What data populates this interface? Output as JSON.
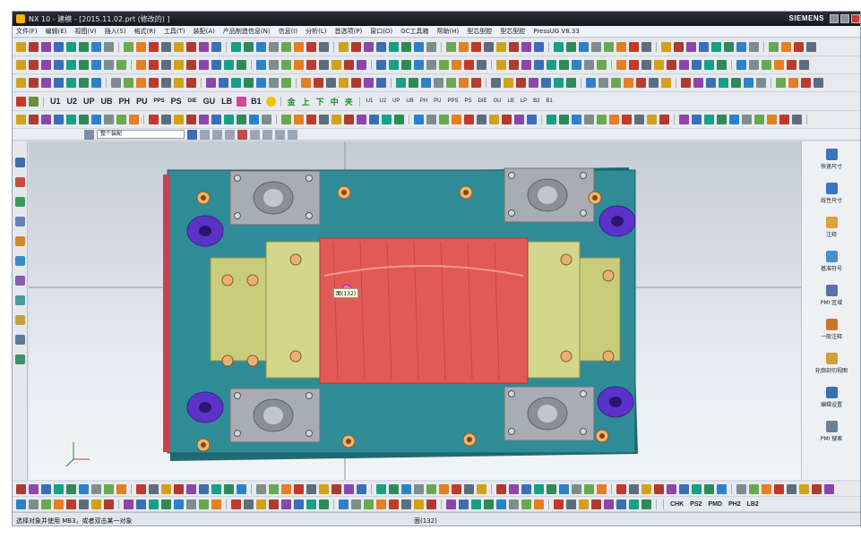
{
  "window": {
    "title": "NX 10 - 建模 - [2015.11.02.prt (修改的) ]",
    "brand": "SIEMENS"
  },
  "menubar": {
    "items": [
      "文件(F)",
      "编辑(E)",
      "视图(V)",
      "插入(S)",
      "格式(R)",
      "工具(T)",
      "装配(A)",
      "产品制造信息(N)",
      "信息(I)",
      "分析(L)",
      "首选项(P)",
      "窗口(O)",
      "GC工具箱",
      "帮助(H)",
      "型芯型腔",
      "型芯型腔",
      "PressUG V8.33"
    ]
  },
  "toolbar_mold": {
    "labels": [
      "U1",
      "U2",
      "UP",
      "UB",
      "PH",
      "PU",
      "PPS",
      "PS",
      "DIE",
      "GU",
      "LB",
      "B1"
    ]
  },
  "toolbar_mold_right": {
    "labels": [
      "U1",
      "U2",
      "UP",
      "UB",
      "PH",
      "PU",
      "PPS",
      "PS",
      "DIE",
      "GU",
      "LB",
      "LP",
      "B2",
      "B1"
    ]
  },
  "toolbar_mold_cn": {
    "labels": [
      "金",
      "上",
      "下",
      "中",
      "夹"
    ]
  },
  "selection": {
    "filter_value": "整个装配"
  },
  "viewport": {
    "tooltip": "面(132)"
  },
  "right_panel": {
    "items": [
      "快速尺寸",
      "线性尺寸",
      "注释",
      "基准符号",
      "PMI 区域",
      "一般注释",
      "轮廓剖切视图",
      "编辑设置",
      "PMI 搜索"
    ]
  },
  "bottom_toolbar": {
    "labels": [
      "CHK",
      "PS2",
      "PMD",
      "PH2",
      "LB2"
    ]
  },
  "status": {
    "prompt": "选择对象并使用 MB3，或者双击某一对象",
    "selection_info": "面(132)"
  },
  "colors": {
    "plate": "#2f8c96",
    "cavity": "#e25a55",
    "slider": "#c9cc78",
    "clamp": "#a9adb3",
    "ring": "#5b33c9"
  }
}
